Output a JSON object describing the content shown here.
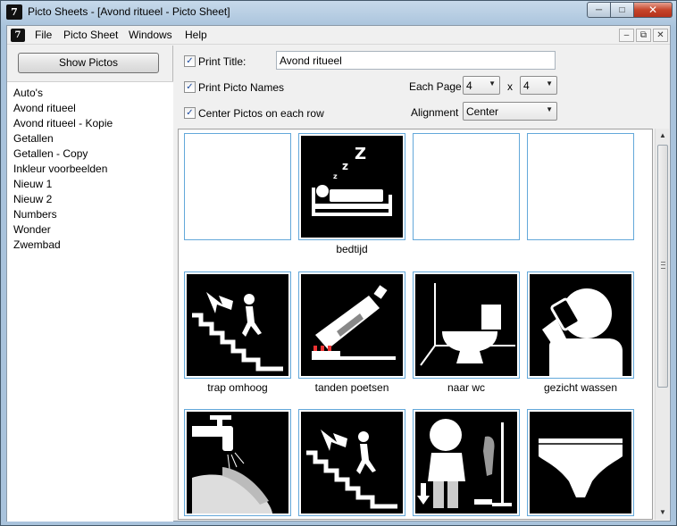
{
  "window": {
    "title": "Picto Sheets - [Avond ritueel - Picto Sheet]"
  },
  "menu": {
    "items": [
      "File",
      "Picto Sheet",
      "Windows",
      "Help"
    ]
  },
  "sidebar": {
    "show_button": "Show Pictos",
    "sheets": [
      "Auto's",
      "Avond ritueel",
      "Avond ritueel - Kopie",
      "Getallen",
      "Getallen - Copy",
      "Inkleur voorbeelden",
      "Nieuw 1",
      "Nieuw 2",
      "Numbers",
      "Wonder",
      "Zwembad"
    ]
  },
  "options": {
    "print_title": {
      "label": "Print Title:",
      "checked": true,
      "value": "Avond ritueel"
    },
    "print_names": {
      "label": "Print Picto Names",
      "checked": true
    },
    "center": {
      "label": "Center Pictos on each row",
      "checked": true
    },
    "each_page": {
      "label": "Each Page",
      "cols": "4",
      "separator": "x",
      "rows": "4"
    },
    "alignment": {
      "label": "Alignment",
      "value": "Center"
    }
  },
  "grid": {
    "rows": [
      [
        {
          "name": "",
          "icon": "empty"
        },
        {
          "name": "bedtijd",
          "icon": "sleeping-in-bed-icon"
        },
        {
          "name": "",
          "icon": "empty"
        },
        {
          "name": "",
          "icon": "empty"
        }
      ],
      [
        {
          "name": "trap omhoog",
          "icon": "stairs-up-icon"
        },
        {
          "name": "tanden poetsen",
          "icon": "toothbrush-toothpaste-icon"
        },
        {
          "name": "naar wc",
          "icon": "toilet-icon"
        },
        {
          "name": "gezicht wassen",
          "icon": "wash-face-icon"
        }
      ],
      [
        {
          "name": "",
          "icon": "washing-hands-icon"
        },
        {
          "name": "",
          "icon": "stairs-up-icon"
        },
        {
          "name": "",
          "icon": "undressing-icon"
        },
        {
          "name": "",
          "icon": "underpants-icon"
        }
      ]
    ]
  }
}
